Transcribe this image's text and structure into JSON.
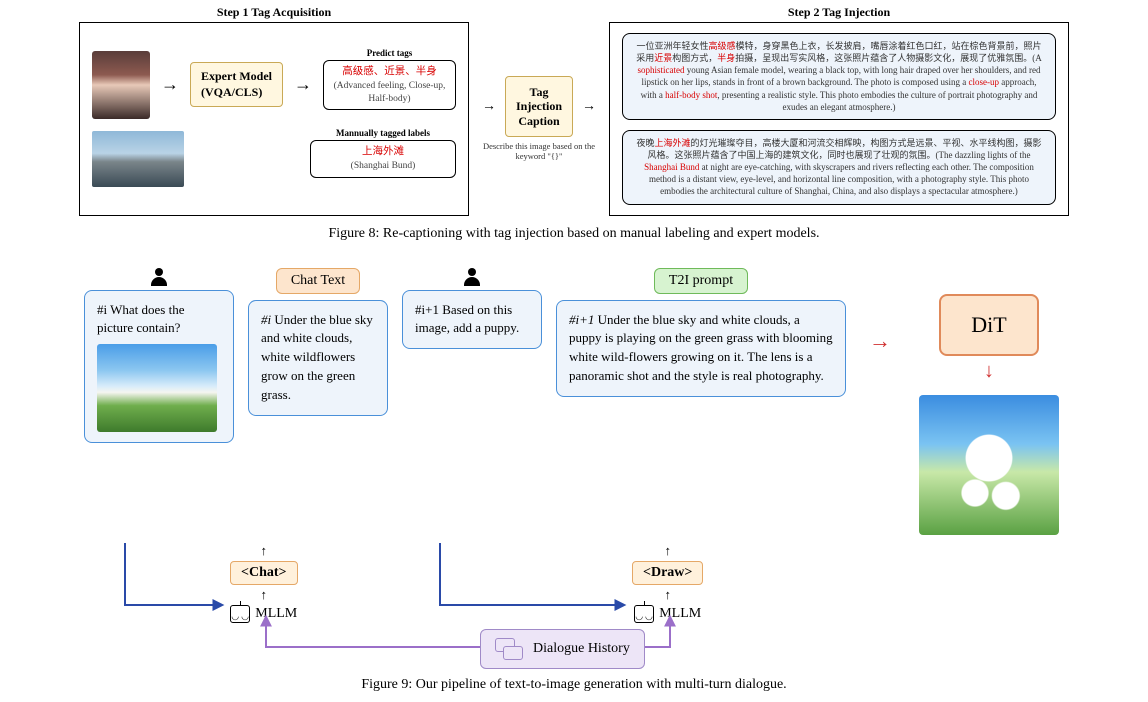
{
  "fig8": {
    "step1": "Step 1 Tag Acquisition",
    "step2": "Step 2 Tag Injection",
    "expert_l1": "Expert Model",
    "expert_l2": "(VQA/CLS)",
    "predict_label": "Predict tags",
    "predict_cn": "高级感、近景、半身",
    "predict_en": "(Advanced feeling,  Close-up, Half-body)",
    "manual_label": "Mannually tagged labels",
    "manual_cn": "上海外滩",
    "manual_en": "(Shanghai Bund)",
    "inject_l1": "Tag Injection",
    "inject_l2": "Caption",
    "inject_sub": "Describe this image based on the keyword \"{}\"",
    "out1_cn_p1": "一位亚洲年轻女性",
    "out1_cn_hl1": "高级感",
    "out1_cn_p2": "模特，身穿黑色上衣，长发披肩，嘴唇涂着红色口红，站在棕色背景前，照片采用",
    "out1_cn_hl2": "近景",
    "out1_cn_p3": "构图方式，",
    "out1_cn_hl3": "半身",
    "out1_cn_p4": "拍摄，呈现出写实风格，这张照片蕴含了人物摄影文化，展现了优雅氛围。(A ",
    "out1_en_hl1": "sophisticated",
    "out1_en_p1": " young Asian female model, wearing a black top, with long hair draped over her shoulders, and red lipstick on her lips, stands in front of a brown background. The photo is composed using a ",
    "out1_en_hl2": "close-up",
    "out1_en_p2": " approach, with a ",
    "out1_en_hl3": "half-body shot",
    "out1_en_p3": ", presenting a realistic style. This photo embodies the culture of portrait photography and exudes an elegant atmosphere.)",
    "out2_cn_p1": "夜晚",
    "out2_cn_hl1": "上海外滩",
    "out2_cn_p2": "的灯光璀璨夺目，高楼大厦和河流交相辉映，构图方式是远景、平视、水平线构图，摄影风格。这张照片蕴含了中国上海的建筑文化，同时也展现了壮观的氛围。(The dazzling lights of the ",
    "out2_en_hl1": "Shanghai Bund",
    "out2_en_p1": " at night are eye-catching, with skyscrapers and rivers reflecting each other. The composition method is a distant view, eye-level, and horizontal line composition, with a photography style. This photo embodies the architectural culture of Shanghai, China, and also displays a spectacular atmosphere.)",
    "caption": "Figure 8: Re-captioning with tag injection based on manual labeling and expert models."
  },
  "fig9": {
    "q1": "#i  What does the picture contain?",
    "chat_label": "Chat Text",
    "a1_idx": "#i",
    "a1_body": "  Under the blue sky and white clouds, white wildflowers grow on the green grass.",
    "q2": "#i+1  Based on this image, add a puppy.",
    "t2i_label": "T2I prompt",
    "a2_idx": "#i+1",
    "a2_body": " Under the blue sky and white clouds, a puppy is playing on the green grass with blooming white wild-flowers growing on it. The lens is a panoramic shot and the style is real photography.",
    "dit": "DiT",
    "chat_token": "<Chat>",
    "draw_token": "<Draw>",
    "mllm": "MLLM",
    "dialogue": "Dialogue History",
    "caption": "Figure 9: Our pipeline of text-to-image generation with multi-turn dialogue."
  }
}
